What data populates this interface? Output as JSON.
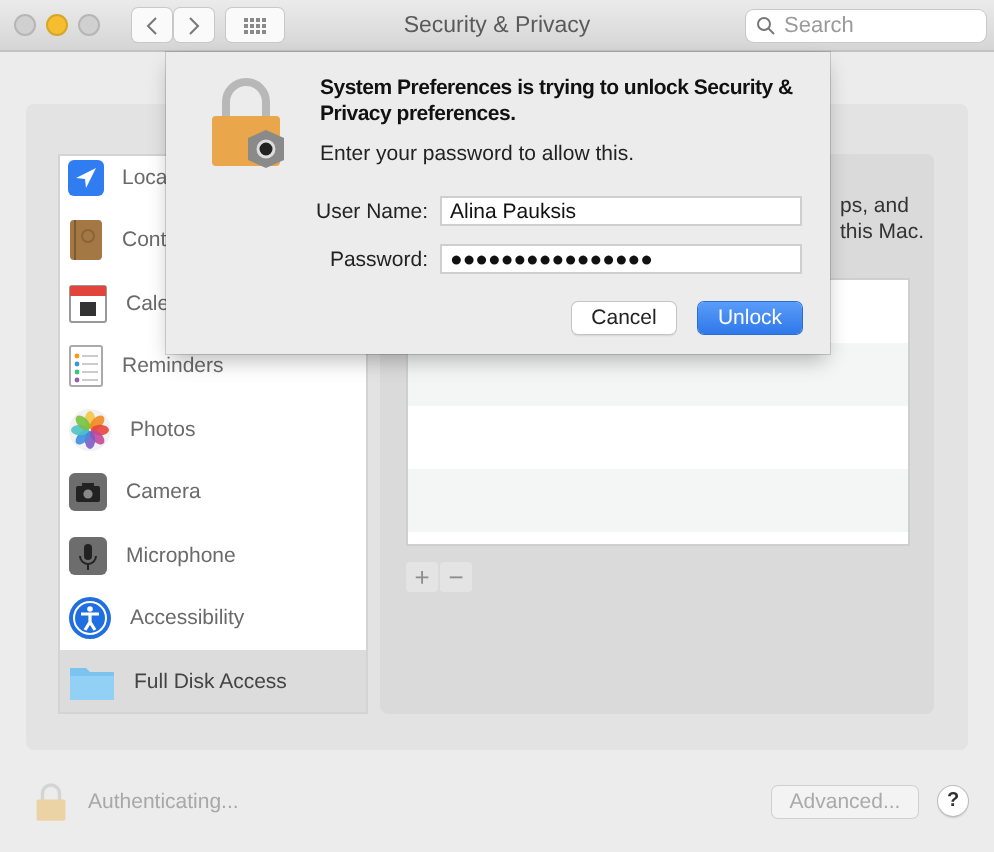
{
  "window": {
    "title": "Security & Privacy"
  },
  "toolbar": {
    "search": {
      "placeholder": "Search"
    }
  },
  "sidebar": {
    "items": [
      {
        "label": "Loca",
        "selected": false
      },
      {
        "label": "Cont",
        "selected": false
      },
      {
        "label": "Cale",
        "selected": false
      },
      {
        "label": "Reminders",
        "selected": false
      },
      {
        "label": "Photos",
        "selected": false
      },
      {
        "label": "Camera",
        "selected": false
      },
      {
        "label": "Microphone",
        "selected": false
      },
      {
        "label": "Accessibility",
        "selected": false
      },
      {
        "label": "Full Disk Access",
        "selected": true
      }
    ]
  },
  "pane": {
    "description_lines": [
      "ps, and",
      "this Mac."
    ],
    "list_buttons": [
      {
        "label": "+",
        "disabled": true
      },
      {
        "label": "−",
        "disabled": true
      }
    ]
  },
  "footer": {
    "status": "Authenticating...",
    "advanced_button": {
      "label": "Advanced...",
      "disabled": true
    },
    "help_button": {
      "label": "?"
    }
  },
  "dialog": {
    "title": "System Preferences is trying to unlock Security & Privacy preferences.",
    "message": "Enter your password to allow this.",
    "fields": [
      {
        "label": "User Name:",
        "value": "Alina Pauksis"
      },
      {
        "label": "Password:",
        "value": "●●●●●●●●●●●●●●●●"
      }
    ],
    "buttons": [
      {
        "label": "Cancel",
        "default": false
      },
      {
        "label": "Unlock",
        "default": true
      }
    ]
  }
}
